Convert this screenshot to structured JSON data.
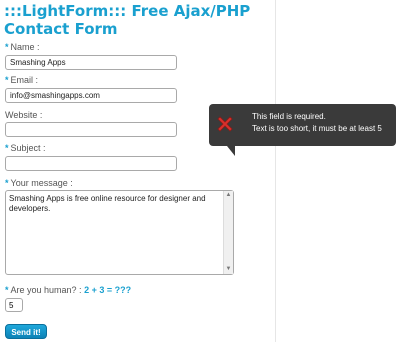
{
  "form": {
    "title_line1": ":::LightForm::: Free Ajax/PHP",
    "title_line2": "Contact Form",
    "name": {
      "label": "Name :",
      "value": "Smashing Apps"
    },
    "email": {
      "label": "Email :",
      "value": "info@smashingapps.com"
    },
    "website": {
      "label": "Website :",
      "value": ""
    },
    "subject": {
      "label": "Subject :",
      "value": ""
    },
    "message": {
      "label": "Your message :",
      "value": "Smashing Apps is free online resource for designer and developers."
    },
    "captcha": {
      "label": "Are you human? :",
      "question": "2 + 3 = ???",
      "value": "5"
    },
    "submit_label": "Send it!"
  },
  "tooltip": {
    "line1": "This field is required.",
    "line2": "Text is too short, it must be at least 5",
    "icon": "error-x-icon"
  },
  "colors": {
    "accent": "#1aa0cf",
    "tooltip_bg": "#3a3a3a",
    "error_icon": "#d9302c"
  }
}
